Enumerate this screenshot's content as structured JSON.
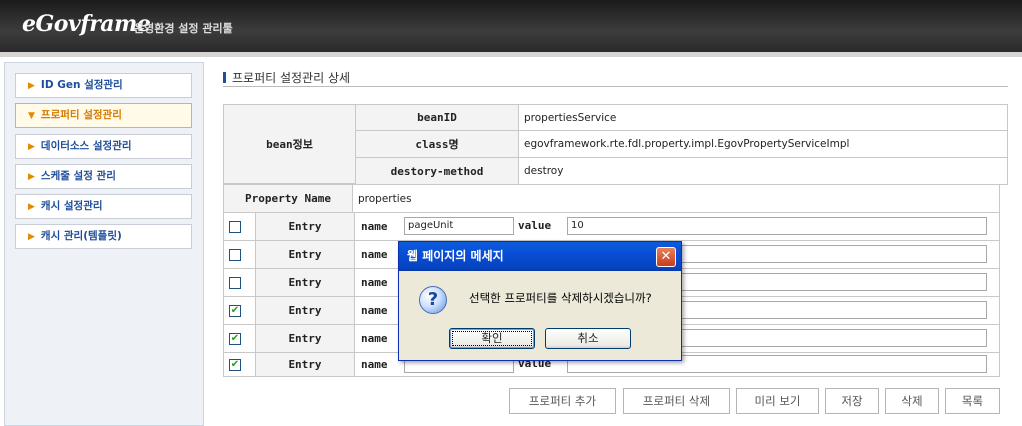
{
  "header": {
    "logo": "eGovframe",
    "subtitle": "운영환경 설정 관리툴"
  },
  "sidebar": {
    "items": [
      {
        "label": "ID Gen 설정관리",
        "active": false
      },
      {
        "label": "프로퍼티 설정관리",
        "active": true
      },
      {
        "label": "데이터소스 설정관리",
        "active": false
      },
      {
        "label": "스케줄 설정 관리",
        "active": false
      },
      {
        "label": "캐시 설정관리",
        "active": false
      },
      {
        "label": "캐시 관리(템플릿)",
        "active": false
      }
    ]
  },
  "section": {
    "title": "프로퍼티 설정관리 상세"
  },
  "bean": {
    "label": "bean정보",
    "rows": [
      {
        "key": "beanID",
        "value": "propertiesService"
      },
      {
        "key": "class명",
        "value": "egovframework.rte.fdl.property.impl.EgovPropertyServiceImpl"
      },
      {
        "key": "destory-method",
        "value": "destroy"
      }
    ]
  },
  "property": {
    "label": "Property Name",
    "value": "properties"
  },
  "entries": [
    {
      "checked": false,
      "label": "Entry",
      "name_label": "name",
      "name": "pageUnit",
      "value_label": "value",
      "value": "10"
    },
    {
      "checked": false,
      "label": "Entry",
      "name_label": "name",
      "name": "",
      "value_label": "value",
      "value": ""
    },
    {
      "checked": false,
      "label": "Entry",
      "name_label": "name",
      "name": "",
      "value_label": "value",
      "value": ""
    },
    {
      "checked": true,
      "label": "Entry",
      "name_label": "name",
      "name": "",
      "value_label": "value",
      "value": ""
    },
    {
      "checked": true,
      "label": "Entry",
      "name_label": "name",
      "name": "",
      "value_label": "value",
      "value": ""
    },
    {
      "checked": true,
      "label": "Entry",
      "name_label": "name",
      "name": "",
      "value_label": "value",
      "value": ""
    }
  ],
  "buttons": {
    "add": "프로퍼티 추가",
    "delete_prop": "프로퍼티 삭제",
    "preview": "미리 보기",
    "save": "저장",
    "delete": "삭제",
    "list": "목록"
  },
  "dialog": {
    "title": "웹 페이지의 메세지",
    "message": "선택한 프로퍼티를 삭제하시겠습니까?",
    "ok": "확인",
    "cancel": "취소",
    "icon": "question-icon"
  },
  "symbols": {
    "check": "✔",
    "menu_arrow": "▶",
    "menu_arrow_active": "▼",
    "close": "✕",
    "question": "?"
  },
  "colors": {
    "title_blue": "#0a4ed6",
    "menu_text": "#1e4e99",
    "active_text": "#d47a00"
  }
}
